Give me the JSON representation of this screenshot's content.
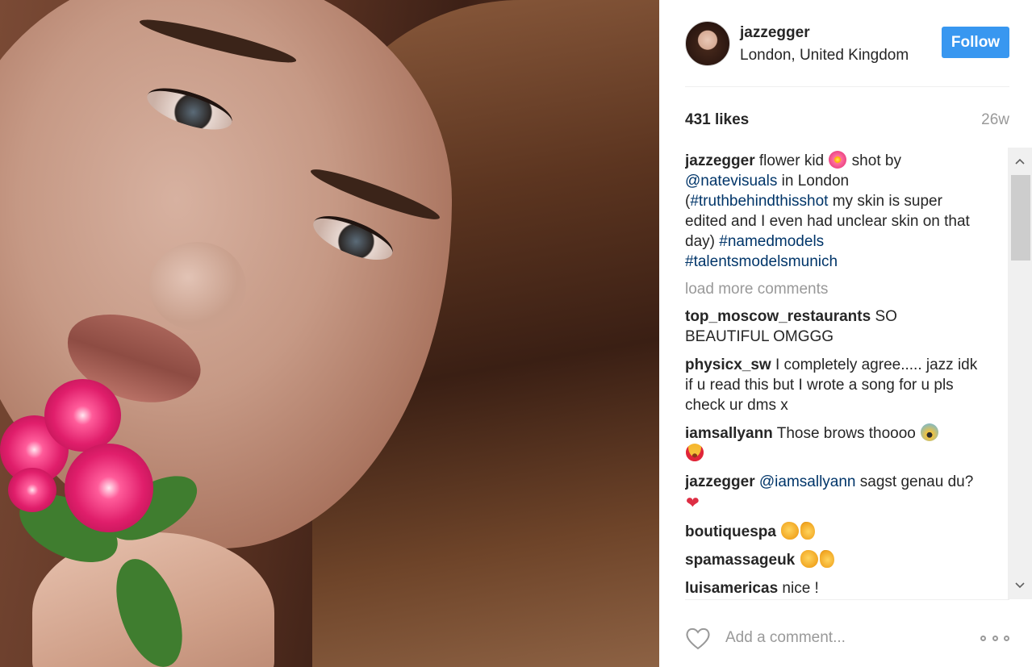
{
  "post": {
    "image_alt": "Close-up portrait photo of a woman holding pink flowers"
  },
  "header": {
    "username": "jazzegger",
    "location": "London, United Kingdom",
    "follow_label": "Follow"
  },
  "stats": {
    "likes": "431 likes",
    "time": "26w"
  },
  "caption": {
    "user": "jazzegger",
    "text_1": " flower kid ",
    "text_2": " shot by ",
    "mention": "@natevisuals",
    "text_3": " in London (",
    "hashtag_1": "#truthbehindthisshot",
    "text_4": " my skin is super edited and I even had unclear skin on that day) ",
    "hashtag_2": "#namedmodels",
    "hashtag_3": "#talentsmodelsmunich"
  },
  "load_more": "load more comments",
  "comments": [
    {
      "user": "top_moscow_restaurants",
      "text": " SO BEAUTIFUL OMGGG"
    },
    {
      "user": "physicx_sw",
      "text": " I completely agree..... jazz idk if u read this but I wrote a song for u pls check ur dms x"
    },
    {
      "user": "iamsallyann",
      "text": " Those brows thoooo "
    },
    {
      "user": "jazzegger",
      "mention": "@iamsallyann",
      "text": " sagst genau du? "
    },
    {
      "user": "boutiquespa",
      "text": " "
    },
    {
      "user": "spamassageuk",
      "text": " "
    },
    {
      "user": "luisamericas",
      "text": " nice !"
    }
  ],
  "emoji": {
    "flower": "hibiscus-icon",
    "scream": "face-screaming-icon",
    "heart_eyes": "heart-eyes-icon",
    "red_heart": "❤",
    "clap": "clapping-hands-icon",
    "ok": "ok-hand-icon"
  },
  "footer": {
    "comment_placeholder": "Add a comment..."
  },
  "colors": {
    "follow_button": "#3897f0",
    "link": "#003569",
    "muted": "#999999",
    "text": "#262626"
  }
}
